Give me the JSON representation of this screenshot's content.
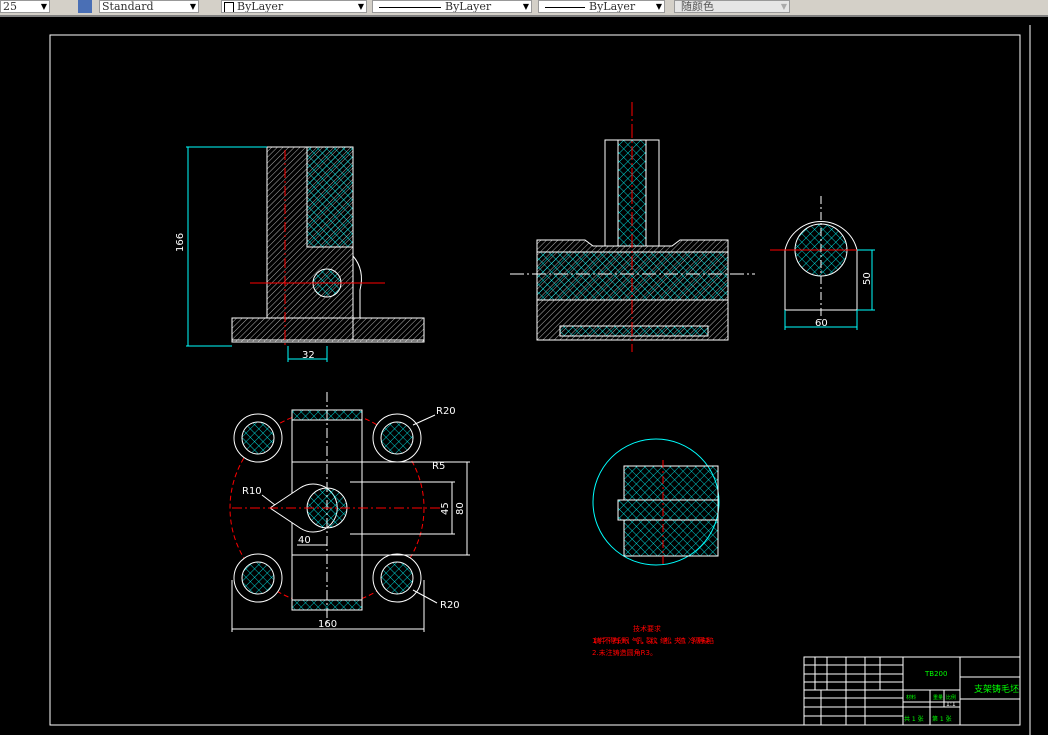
{
  "toolbar": {
    "scale_value": "25",
    "text_style": "Standard",
    "layer": "ByLayer",
    "linetype": "ByLayer",
    "lineweight": "ByLayer",
    "color": "随颜色"
  },
  "colors": {
    "background": "#000000",
    "outline": "#ffffff",
    "hatch": "#00ffff",
    "centerline": "#ff0000",
    "title_text": "#00ff00",
    "notes": "#ff0000"
  },
  "dimensions": {
    "height_166": "166",
    "width_32": "32",
    "height_50": "50",
    "width_60": "60",
    "r20_top": "R20",
    "r5": "R5",
    "r10": "R10",
    "dim_45": "45",
    "dim_80": "80",
    "dim_40": "40",
    "width_160": "160",
    "r20_bottom": "R20"
  },
  "notes": {
    "title": "技术要求",
    "line1": "1.铸件不得有砂眼、气孔、裂纹、缩松、夹渣、冷隔等缺陷",
    "line2": "2.未注铸造圆角R3。"
  },
  "title_block": {
    "code": "TB200",
    "part_name": "支架铸毛坯",
    "scale": "1:1",
    "sheet_total": "共 1 张",
    "sheet_no": "第 1 张",
    "material": "材料",
    "weight": "重量",
    "scale_label": "比例"
  }
}
